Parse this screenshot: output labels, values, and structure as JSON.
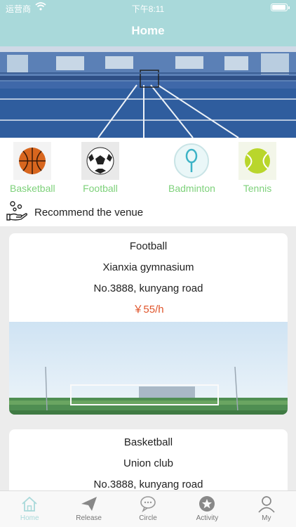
{
  "status": {
    "carrier": "运营商",
    "time": "下午8:11"
  },
  "header": {
    "title": "Home"
  },
  "categories": [
    {
      "label": "Basketball",
      "icon": "basketball-icon"
    },
    {
      "label": "Football",
      "icon": "football-icon"
    },
    {
      "label": "Badminton",
      "icon": "badminton-icon"
    },
    {
      "label": "Tennis",
      "icon": "tennis-ball-icon"
    }
  ],
  "recommend": {
    "title": "Recommend the venue",
    "icon": "recommend-hand-icon"
  },
  "venues": [
    {
      "sport": "Football",
      "name": "Xianxia gymnasium",
      "address": "No.3888, kunyang road",
      "price": "￥55/h"
    },
    {
      "sport": "Basketball",
      "name": "Union club",
      "address": "No.3888, kunyang road"
    }
  ],
  "tabs": [
    {
      "label": "Home",
      "icon": "home-icon",
      "active": true
    },
    {
      "label": "Release",
      "icon": "paper-plane-icon"
    },
    {
      "label": "Circle",
      "icon": "chat-bubble-icon"
    },
    {
      "label": "Activity",
      "icon": "star-badge-icon"
    },
    {
      "label": "My",
      "icon": "user-icon"
    }
  ],
  "colors": {
    "header": "#a9d9da",
    "category_label": "#7dd17a",
    "price": "#e0542a",
    "active_tab": "#a9d9da"
  }
}
